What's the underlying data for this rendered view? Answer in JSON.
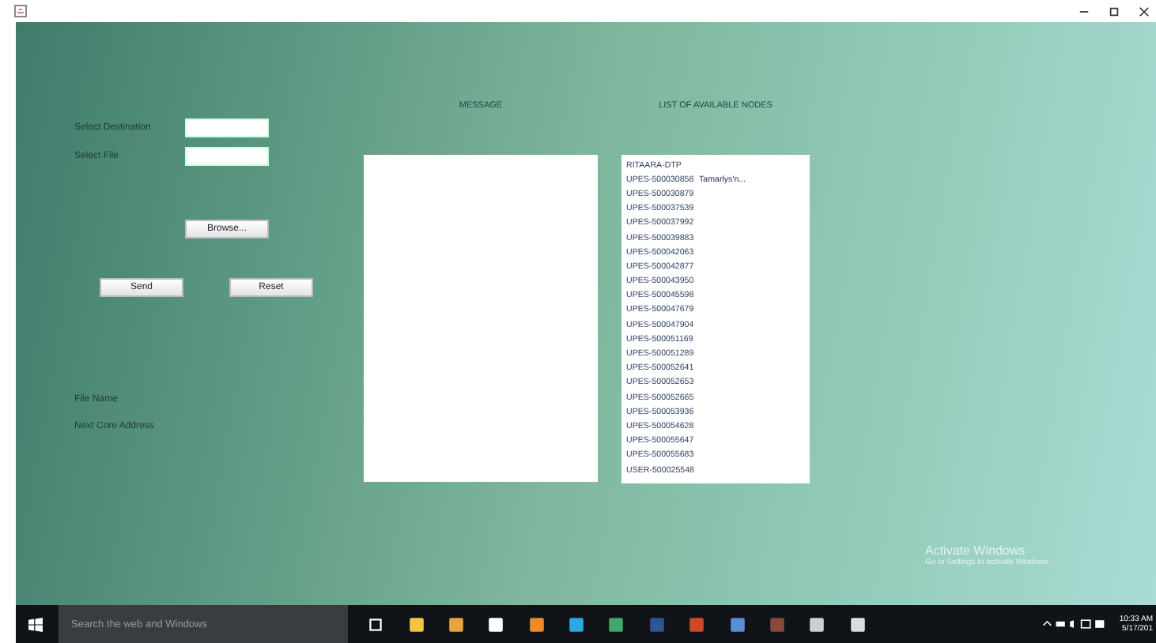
{
  "form": {
    "fields": [
      {
        "label": "Select Destination"
      },
      {
        "label": "Select File"
      }
    ],
    "browse_button": "Browse...",
    "send_button": "Send",
    "reset_button": "Reset",
    "info": [
      {
        "label": "File Name"
      },
      {
        "label": "Next Core Address"
      }
    ]
  },
  "message": {
    "heading": "MESSAGE"
  },
  "nodes": {
    "heading": "LIST OF AVAILABLE NODES",
    "rows": [
      {
        "name": "RITAARA-DTP"
      },
      {
        "name": "UPES-500030858",
        "column_2": "Tamarlys'n..."
      },
      {
        "name": "UPES-500030879"
      },
      {
        "name": "UPES-500037539"
      },
      {
        "name": "UPES-500037992"
      },
      {
        "name": "UPES-500039883"
      },
      {
        "name": "UPES-500042063"
      },
      {
        "name": "UPES-500042877"
      },
      {
        "name": "UPES-500043950"
      },
      {
        "name": "UPES-500045598"
      },
      {
        "name": "UPES-500047679"
      },
      {
        "name": "UPES-500047904"
      },
      {
        "name": "UPES-500051169"
      },
      {
        "name": "UPES-500051289"
      },
      {
        "name": "UPES-500052641"
      },
      {
        "name": "UPES-500052653"
      },
      {
        "name": "UPES-500052665"
      },
      {
        "name": "UPES-500053936"
      },
      {
        "name": "UPES-500054628"
      },
      {
        "name": "UPES-500055647"
      },
      {
        "name": "UPES-500055683"
      },
      {
        "name": "USER-500025548"
      }
    ]
  },
  "activation": {
    "title": "Activate Windows",
    "subtitle": "Go to Settings to activate Windows."
  },
  "taskbar": {
    "search_placeholder": "Search the web and Windows",
    "time": "10:33 AM",
    "date": "5/17/201"
  }
}
